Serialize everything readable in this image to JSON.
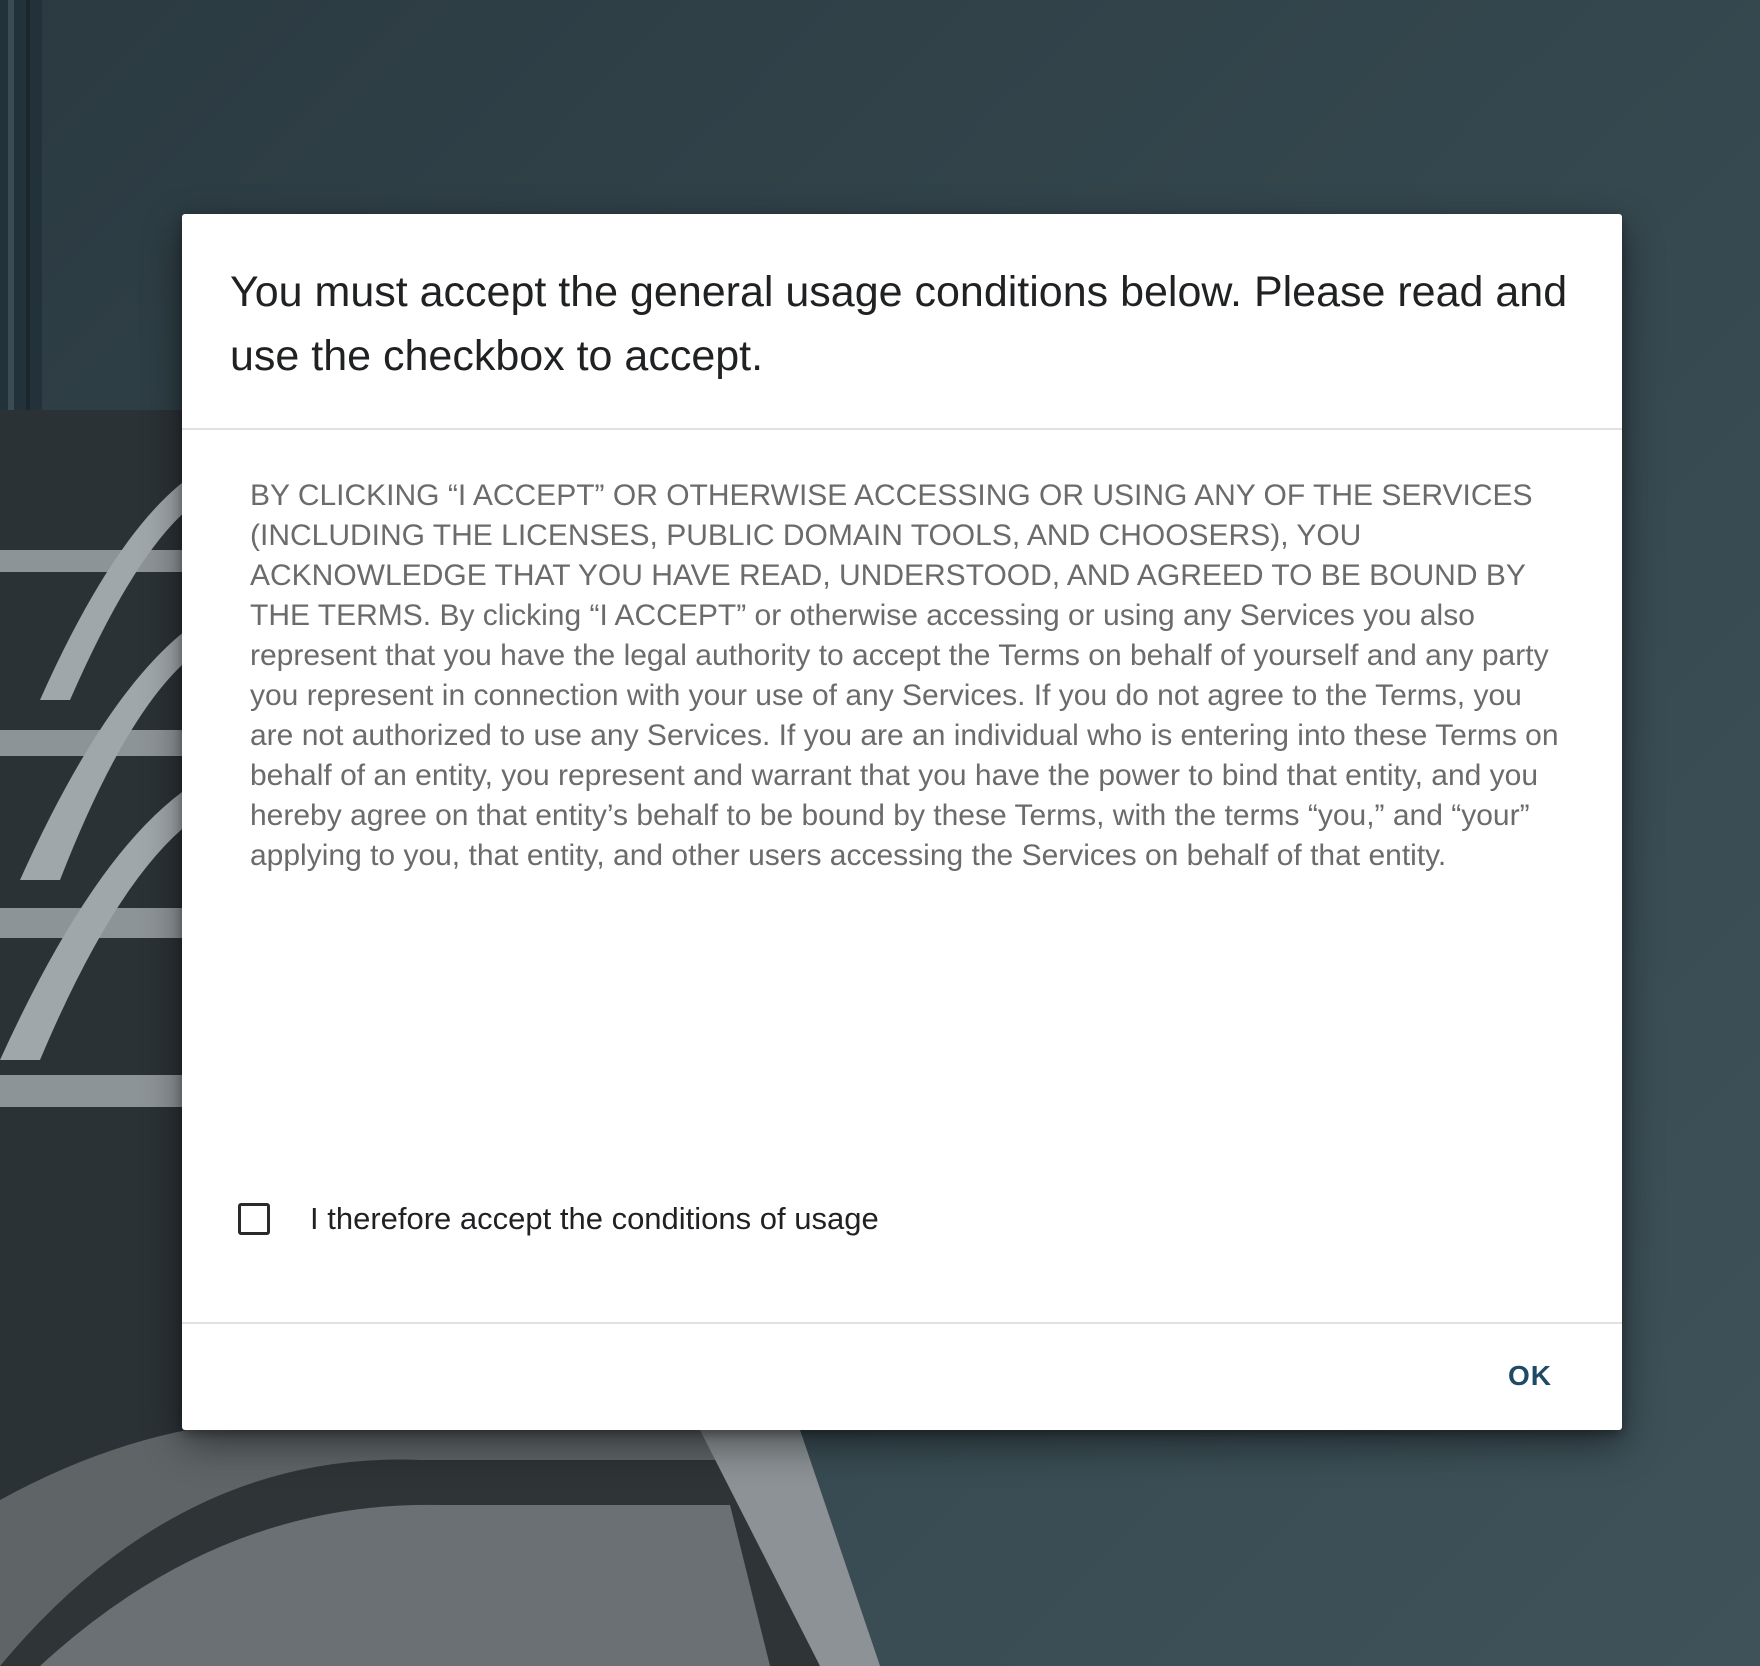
{
  "dialog": {
    "title": "You must accept the general usage conditions below. Please read and use the checkbox to accept.",
    "terms_text": "BY CLICKING “I ACCEPT” OR OTHERWISE ACCESSING OR USING ANY OF THE SERVICES (INCLUDING THE LICENSES, PUBLIC DOMAIN TOOLS, AND CHOOSERS), YOU ACKNOWLEDGE THAT YOU HAVE READ, UNDERSTOOD, AND AGREED TO BE BOUND BY THE TERMS. By clicking “I ACCEPT” or otherwise accessing or using any Services you also represent that you have the legal authority to accept the Terms on behalf of yourself and any party you represent in connection with your use of any Services. If you do not agree to the Terms, you are not authorized to use any Services. If you are an individual who is entering into these Terms on behalf of an entity, you represent and warrant that you have the power to bind that entity, and you hereby agree on that entity’s behalf to be bound by these Terms, with the terms “you,” and “your” applying to you, that entity, and other users accessing the Services on behalf of that entity.",
    "accept_checkbox": {
      "label": "I therefore accept the conditions of usage",
      "checked": false
    },
    "ok_label": "OK"
  },
  "colors": {
    "accent": "#1f4a66",
    "title_text": "#1f2123",
    "body_text": "#6b6b6b",
    "backdrop": "#2f3e45"
  }
}
